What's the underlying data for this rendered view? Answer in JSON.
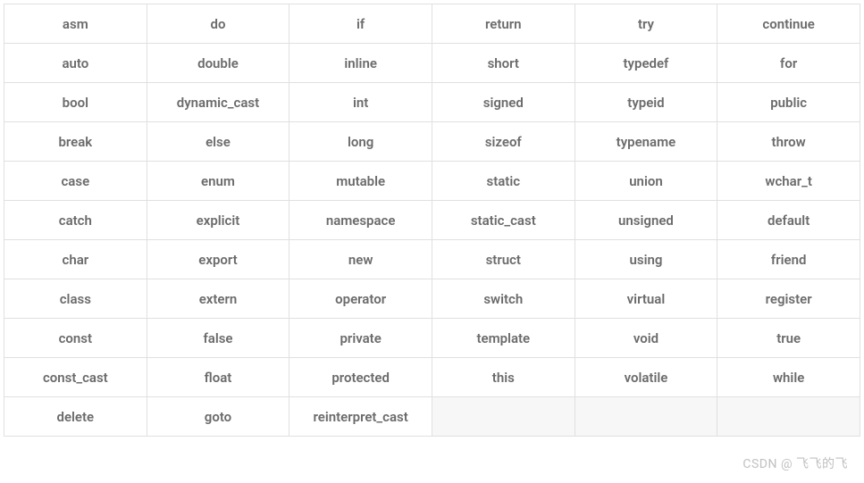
{
  "table": {
    "rows": [
      [
        "asm",
        "do",
        "if",
        "return",
        "try",
        "continue"
      ],
      [
        "auto",
        "double",
        "inline",
        "short",
        "typedef",
        "for"
      ],
      [
        "bool",
        "dynamic_cast",
        "int",
        "signed",
        "typeid",
        "public"
      ],
      [
        "break",
        "else",
        "long",
        "sizeof",
        "typename",
        "throw"
      ],
      [
        "case",
        "enum",
        "mutable",
        "static",
        "union",
        "wchar_t"
      ],
      [
        "catch",
        "explicit",
        "namespace",
        "static_cast",
        "unsigned",
        "default"
      ],
      [
        "char",
        "export",
        "new",
        "struct",
        "using",
        "friend"
      ],
      [
        "class",
        "extern",
        "operator",
        "switch",
        "virtual",
        "register"
      ],
      [
        "const",
        "false",
        "private",
        "template",
        "void",
        "true"
      ],
      [
        "const_cast",
        "float",
        "protected",
        "this",
        "volatile",
        "while"
      ],
      [
        "delete",
        "goto",
        "reinterpret_cast",
        "",
        "",
        ""
      ]
    ]
  },
  "watermark": "CSDN @ 飞飞的飞"
}
